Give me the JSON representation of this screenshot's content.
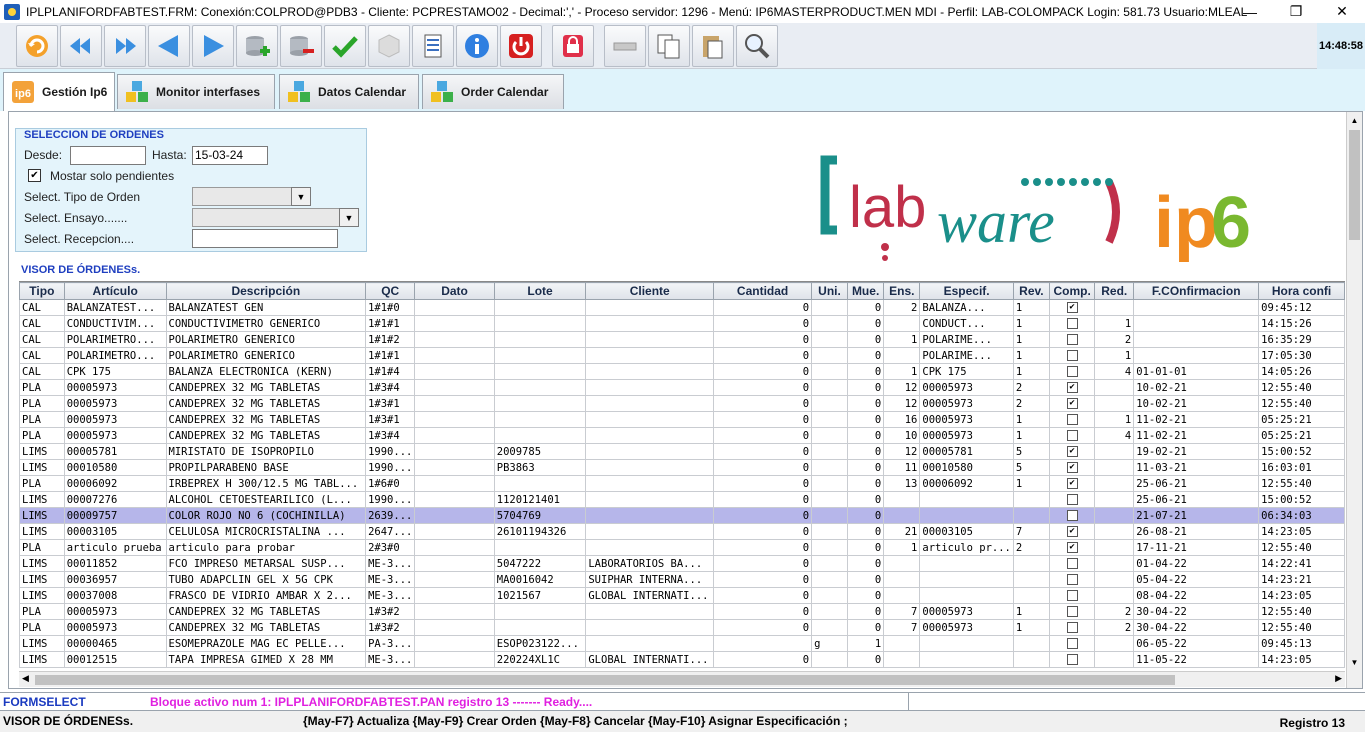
{
  "window": {
    "title": "IPLPLANIFORDFABTEST.FRM:      Conexión:COLPROD@PDB3 - Cliente: PCPRESTAMO02 - Decimal:',' - Proceso servidor: 1296 - Menú: IP6MASTERPRODUCT.MEN MDI - Perfil: LAB-COLOMPACK Login: 581.73      Usuario:MLEAL",
    "clock": "14:48:58"
  },
  "tabs": [
    {
      "label": "Gestión Ip6"
    },
    {
      "label": "Monitor interfases"
    },
    {
      "label": "Datos Calendar"
    },
    {
      "label": "Order Calendar"
    }
  ],
  "selection": {
    "title": "SELECCION DE ORDENES",
    "desde_label": "Desde:",
    "desde_value": "",
    "hasta_label": "Hasta:",
    "hasta_value": "15-03-24",
    "pendientes_label": "Mostar solo pendientes",
    "pendientes_checked": "✔",
    "tipo_label": "Select. Tipo de Orden",
    "ensayo_label": "Select. Ensayo.......",
    "recepcion_label": "Select. Recepcion...."
  },
  "visor": {
    "title": "VISOR DE ÓRDENESs.",
    "columns": [
      "Tipo",
      "Artículo",
      "Descripción",
      "QC",
      "Dato",
      "Lote",
      "Cliente",
      "Cantidad",
      "Uni.",
      "Mue.",
      "Ens.",
      "Especif.",
      "Rev.",
      "Comp.",
      "Red.",
      "F.COnfirmacion",
      "Hora confi"
    ],
    "rows": [
      [
        "CAL",
        "BALANZATEST...",
        "BALANZATEST GEN",
        "1#1#0",
        "",
        "",
        "",
        "0",
        "",
        "0",
        "2",
        "BALANZA...",
        "1",
        "✔",
        "",
        "",
        "09:45:12"
      ],
      [
        "CAL",
        "CONDUCTIVIM...",
        "CONDUCTIVIMETRO GENERICO",
        "1#1#1",
        "",
        "",
        "",
        "0",
        "",
        "0",
        "",
        "CONDUCT...",
        "1",
        "",
        "1",
        "",
        "14:15:26"
      ],
      [
        "CAL",
        "POLARIMETRO...",
        "POLARIMETRO GENERICO",
        "1#1#2",
        "",
        "",
        "",
        "0",
        "",
        "0",
        "1",
        "POLARIME...",
        "1",
        "",
        "2",
        "",
        "16:35:29"
      ],
      [
        "CAL",
        "POLARIMETRO...",
        "POLARIMETRO GENERICO",
        "1#1#1",
        "",
        "",
        "",
        "0",
        "",
        "0",
        "",
        "POLARIME...",
        "1",
        "",
        "1",
        "",
        "17:05:30"
      ],
      [
        "CAL",
        "CPK 175",
        "BALANZA ELECTRONICA (KERN)",
        "1#1#4",
        "",
        "",
        "",
        "0",
        "",
        "0",
        "1",
        "CPK 175",
        "1",
        "",
        "4",
        "01-01-01",
        "14:05:26"
      ],
      [
        "PLA",
        "00005973",
        "CANDEPREX 32 MG TABLETAS",
        "1#3#4",
        "",
        "",
        "",
        "0",
        "",
        "0",
        "12",
        "00005973",
        "2",
        "✔",
        "",
        "10-02-21",
        "12:55:40"
      ],
      [
        "PLA",
        "00005973",
        "CANDEPREX 32 MG TABLETAS",
        "1#3#1",
        "",
        "",
        "",
        "0",
        "",
        "0",
        "12",
        "00005973",
        "2",
        "✔",
        "",
        "10-02-21",
        "12:55:40"
      ],
      [
        "PLA",
        "00005973",
        "CANDEPREX 32 MG TABLETAS",
        "1#3#1",
        "",
        "",
        "",
        "0",
        "",
        "0",
        "16",
        "00005973",
        "1",
        "",
        "1",
        "11-02-21",
        "05:25:21"
      ],
      [
        "PLA",
        "00005973",
        "CANDEPREX 32 MG TABLETAS",
        "1#3#4",
        "",
        "",
        "",
        "0",
        "",
        "0",
        "10",
        "00005973",
        "1",
        "",
        "4",
        "11-02-21",
        "05:25:21"
      ],
      [
        "LIMS",
        "00005781",
        "MIRISTATO DE ISOPROPILO",
        "1990...",
        "",
        "2009785",
        "",
        "0",
        "",
        "0",
        "12",
        "00005781",
        "5",
        "✔",
        "",
        "19-02-21",
        "15:00:52"
      ],
      [
        "LIMS",
        "00010580",
        "PROPILPARABENO BASE",
        "1990...",
        "",
        "PB3863",
        "",
        "0",
        "",
        "0",
        "11",
        "00010580",
        "5",
        "✔",
        "",
        "11-03-21",
        "16:03:01"
      ],
      [
        "PLA",
        "00006092",
        "IRBEPREX H 300/12.5 MG TABL...",
        "1#6#0",
        "",
        "",
        "",
        "0",
        "",
        "0",
        "13",
        "00006092",
        "1",
        "✔",
        "",
        "25-06-21",
        "12:55:40"
      ],
      [
        "LIMS",
        "00007276",
        "ALCOHOL CETOESTEARILICO (L...",
        "1990...",
        "",
        "1120121401",
        "",
        "0",
        "",
        "0",
        "",
        "",
        "",
        "",
        "",
        "25-06-21",
        "15:00:52"
      ],
      [
        "LIMS",
        "00009757",
        "COLOR ROJO NO 6 (COCHINILLA)",
        "2639...",
        "",
        "5704769",
        "",
        "0",
        "",
        "0",
        "",
        "",
        "",
        "",
        "",
        "21-07-21",
        "06:34:03"
      ],
      [
        "LIMS",
        "00003105",
        "CELULOSA MICROCRISTALINA ...",
        "2647...",
        "",
        "26101194326",
        "",
        "0",
        "",
        "0",
        "21",
        "00003105",
        "7",
        "✔",
        "",
        "26-08-21",
        "14:23:05"
      ],
      [
        "PLA",
        "articulo prueba",
        "articulo para probar",
        "2#3#0",
        "",
        "",
        "",
        "0",
        "",
        "0",
        "1",
        "articulo pr...",
        "2",
        "✔",
        "",
        "17-11-21",
        "12:55:40"
      ],
      [
        "LIMS",
        "00011852",
        "FCO IMPRESO  METARSAL SUSP...",
        "ME-3...",
        "",
        "5047222",
        "LABORATORIOS BA...",
        "0",
        "",
        "0",
        "",
        "",
        "",
        "",
        "",
        "01-04-22",
        "14:22:41"
      ],
      [
        "LIMS",
        "00036957",
        "TUBO ADAPCLIN GEL  X  5G CPK",
        "ME-3...",
        "",
        "MA0016042",
        "SUIPHAR INTERNA...",
        "0",
        "",
        "0",
        "",
        "",
        "",
        "",
        "",
        "05-04-22",
        "14:23:21"
      ],
      [
        "LIMS",
        "00037008",
        "FRASCO DE VIDRIO AMBAR X 2...",
        "ME-3...",
        "",
        "1021567",
        "GLOBAL INTERNATI...",
        "0",
        "",
        "0",
        "",
        "",
        "",
        "",
        "",
        "08-04-22",
        "14:23:05"
      ],
      [
        "PLA",
        "00005973",
        "CANDEPREX 32 MG TABLETAS",
        "1#3#2",
        "",
        "",
        "",
        "0",
        "",
        "0",
        "7",
        "00005973",
        "1",
        "",
        "2",
        "30-04-22",
        "12:55:40"
      ],
      [
        "PLA",
        "00005973",
        "CANDEPREX 32 MG TABLETAS",
        "1#3#2",
        "",
        "",
        "",
        "0",
        "",
        "0",
        "7",
        "00005973",
        "1",
        "",
        "2",
        "30-04-22",
        "12:55:40"
      ],
      [
        "LIMS",
        "00000465",
        "ESOMEPRAZOLE MAG EC PELLE...",
        "PA-3...",
        "",
        "ESOP023122...",
        "",
        "",
        "g",
        "1",
        "",
        "",
        "",
        "",
        "",
        "06-05-22",
        "09:45:13"
      ],
      [
        "LIMS",
        "00012515",
        "TAPA IMPRESA GIMED X 28 MM",
        "ME-3...",
        "",
        "220224XL1C",
        "GLOBAL INTERNATI...",
        "0",
        "",
        "0",
        "",
        "",
        "",
        "",
        "",
        "11-05-22",
        "14:23:05"
      ]
    ],
    "selected_row_index": 13
  },
  "status": {
    "block": "FORMSELECT",
    "message": "Bloque activo num 1: IPLPLANIFORDFABTEST.PAN  registro 13 ------- Ready....",
    "current_block": "VISOR DE ÓRDENESs.",
    "shortcuts": "{May-F7} Actualiza {May-F9} Crear Orden {May-F8} Cancelar  {May-F10}  Asignar Especificación  ;",
    "record": "Registro 13"
  },
  "colors": {
    "tab_band": "#dff3fb",
    "selected_row": "#b6b6ea",
    "section_title": "#1f3fc0",
    "status_message": "#e020e0"
  }
}
